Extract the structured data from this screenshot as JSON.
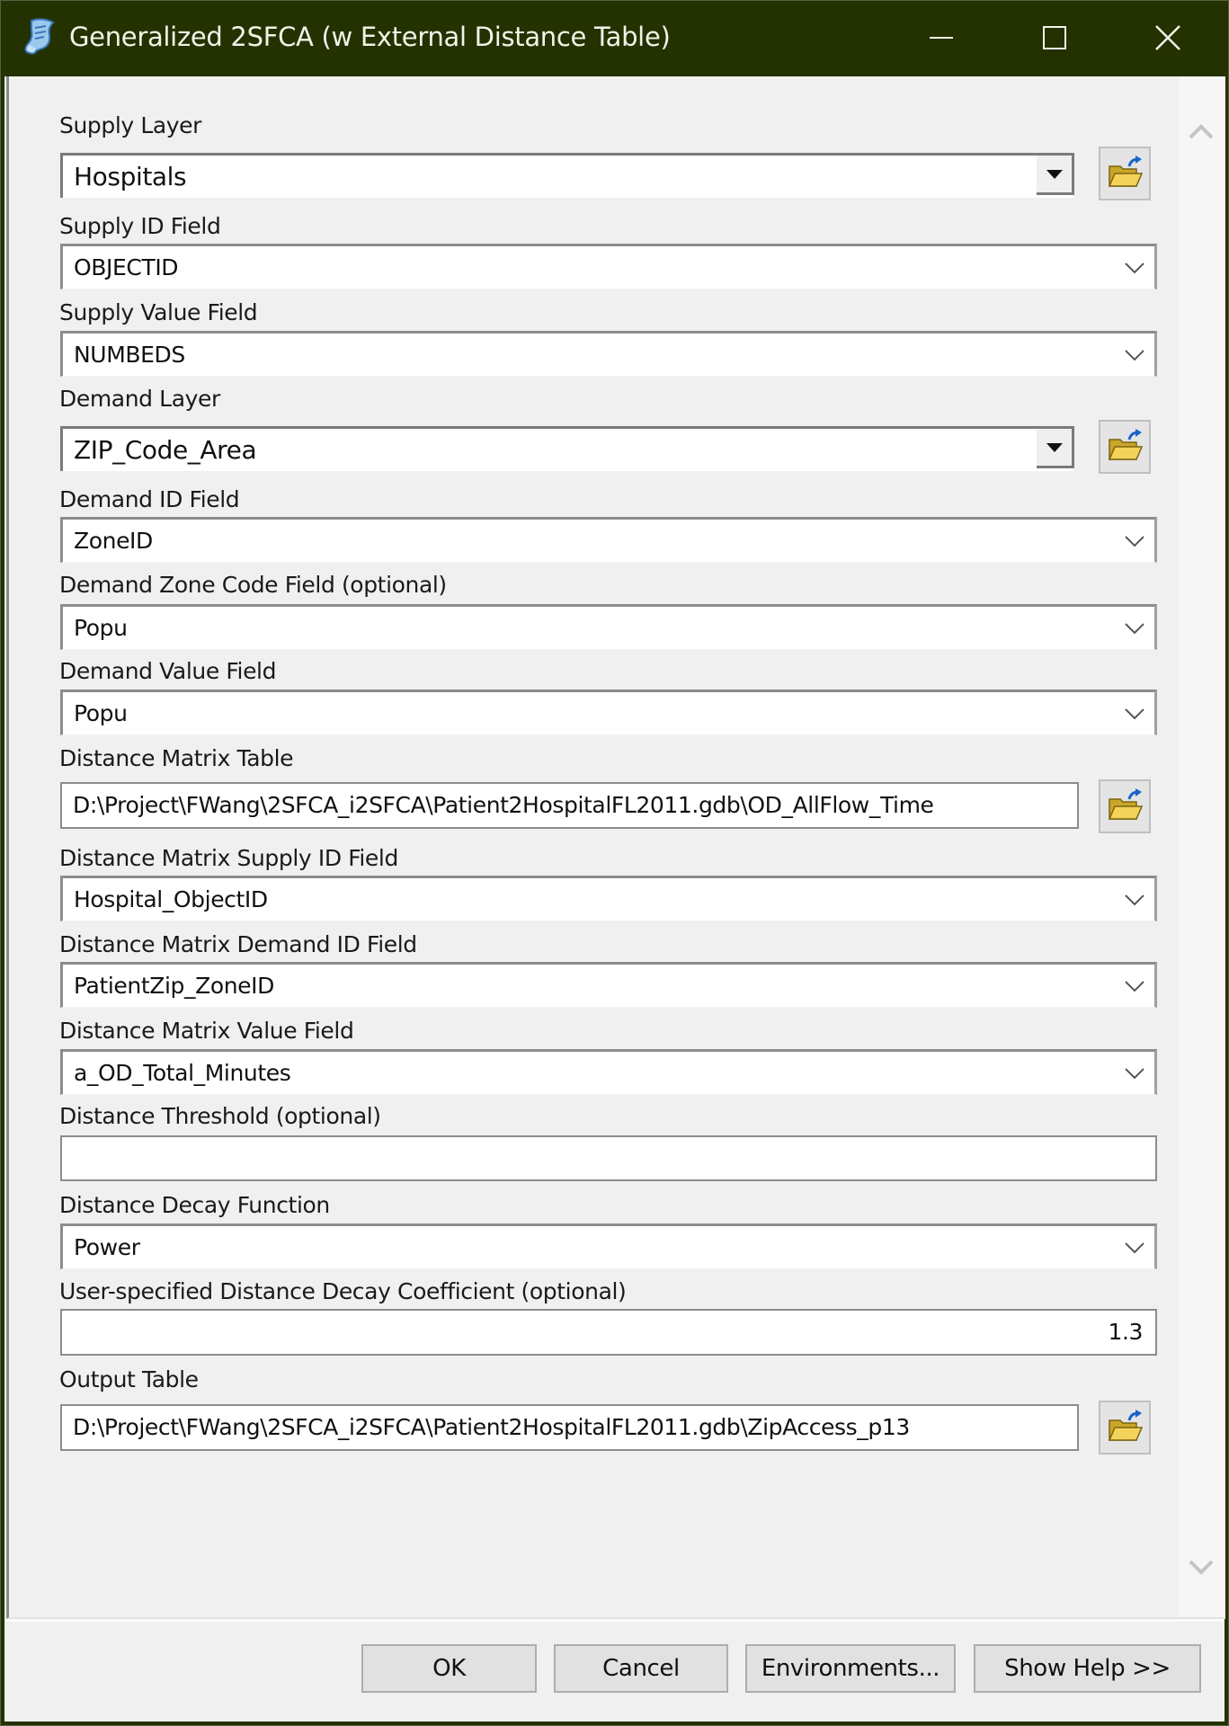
{
  "window": {
    "title": "Generalized 2SFCA (w External Distance Table)",
    "icon": "script-scroll-icon",
    "controls": [
      "minimize",
      "maximize",
      "close"
    ]
  },
  "params": {
    "supply_layer": {
      "label": "Supply Layer",
      "value": "Hospitals",
      "type": "combo-browse"
    },
    "supply_id_field": {
      "label": "Supply ID Field",
      "value": "OBJECTID",
      "type": "dropdown"
    },
    "supply_value_field": {
      "label": "Supply Value Field",
      "value": "NUMBEDS",
      "type": "dropdown"
    },
    "demand_layer": {
      "label": "Demand Layer",
      "value": "ZIP_Code_Area",
      "type": "combo-browse"
    },
    "demand_id_field": {
      "label": "Demand ID Field",
      "value": "ZoneID",
      "type": "dropdown"
    },
    "demand_zone_code_field": {
      "label": "Demand Zone Code Field (optional)",
      "value": "Popu",
      "type": "dropdown"
    },
    "demand_value_field": {
      "label": "Demand Value Field",
      "value": "Popu",
      "type": "dropdown"
    },
    "distance_matrix_table": {
      "label": "Distance Matrix Table",
      "value": "D:\\Project\\FWang\\2SFCA_i2SFCA\\Patient2HospitalFL2011.gdb\\OD_AllFlow_Time",
      "type": "text-browse"
    },
    "dm_supply_id_field": {
      "label": "Distance Matrix Supply ID Field",
      "value": "Hospital_ObjectID",
      "type": "dropdown"
    },
    "dm_demand_id_field": {
      "label": "Distance Matrix Demand ID Field",
      "value": "PatientZip_ZoneID",
      "type": "dropdown"
    },
    "dm_value_field": {
      "label": "Distance Matrix Value Field",
      "value": "a_OD_Total_Minutes",
      "type": "dropdown"
    },
    "distance_threshold": {
      "label": "Distance Threshold (optional)",
      "value": "",
      "type": "text"
    },
    "distance_decay_function": {
      "label": "Distance Decay Function",
      "value": "Power",
      "type": "dropdown"
    },
    "decay_coefficient": {
      "label": "User-specified Distance Decay Coefficient (optional)",
      "value": "1.3",
      "type": "text"
    },
    "output_table": {
      "label": "Output Table",
      "value": "D:\\Project\\FWang\\2SFCA_i2SFCA\\Patient2HospitalFL2011.gdb\\ZipAccess_p13",
      "type": "text-browse"
    }
  },
  "buttons": {
    "ok": "OK",
    "cancel": "Cancel",
    "environments": "Environments...",
    "show_help": "Show Help >>"
  },
  "colors": {
    "titlebar": "#233200",
    "title_text": "#f2f2e6",
    "panel": "#f0f0f0",
    "field": "#ffffff",
    "button": "#e1e1e1"
  }
}
